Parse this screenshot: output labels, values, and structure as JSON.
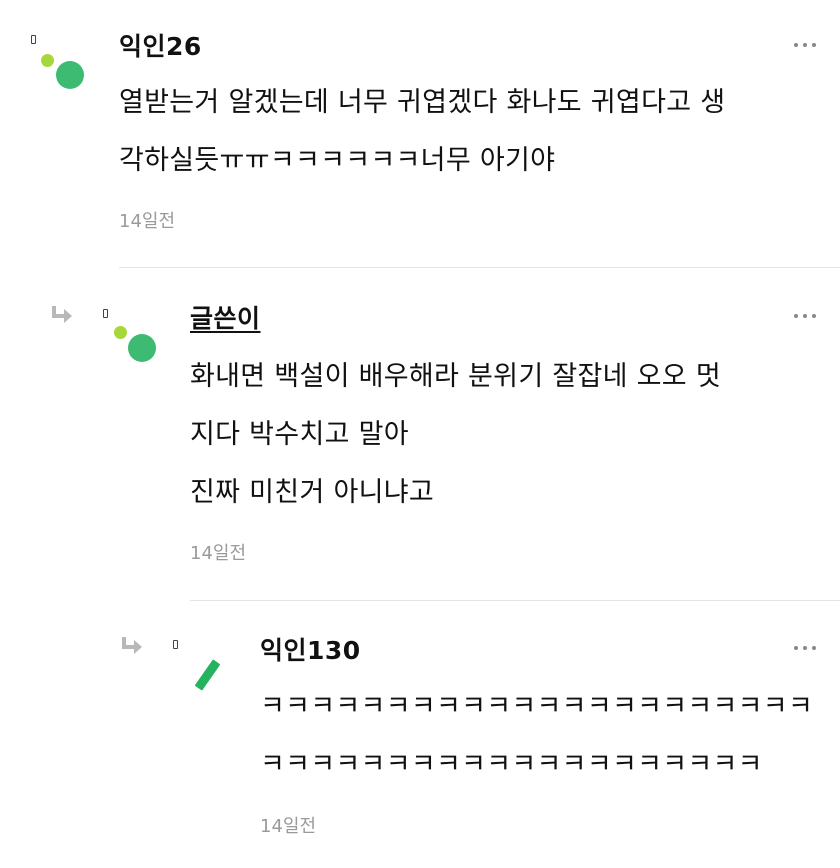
{
  "comments": [
    {
      "author": "익인26",
      "lines": [
        "열받는거 알겠는데 너무 귀엽겠다 화나도 귀엽다고 생",
        "각하실듯ㅠㅠㅋㅋㅋㅋㅋㅋ너무 아기야"
      ],
      "time": "14일전",
      "avatar_icon": "dot-avatar-icon"
    },
    {
      "author": "글쓴이",
      "lines": [
        "화내면 백설이 배우해라 분위기 잘잡네 오오 멋",
        "지다 박수치고 말아",
        "진짜 미친거 아니냐고"
      ],
      "time": "14일전",
      "avatar_icon": "dot-avatar-icon",
      "reply_icon": "reply-arrow-icon"
    },
    {
      "author": "익인130",
      "lines": [
        "ㅋㅋㅋㅋㅋㅋㅋㅋㅋㅋㅋㅋㅋㅋㅋㅋㅋㅋㅋㅋㅋㅋ",
        "ㅋㅋㅋㅋㅋㅋㅋㅋㅋㅋㅋㅋㅋㅋㅋㅋㅋㅋㅋㅋ"
      ],
      "time": "14일전",
      "avatar_icon": "slash-avatar-icon",
      "reply_icon": "reply-arrow-icon"
    }
  ],
  "colors": {
    "dot_small": "#a6d83a",
    "dot_big": "#3dbb72",
    "time_text": "#9a9a9a",
    "divider": "#e4e4e4"
  }
}
